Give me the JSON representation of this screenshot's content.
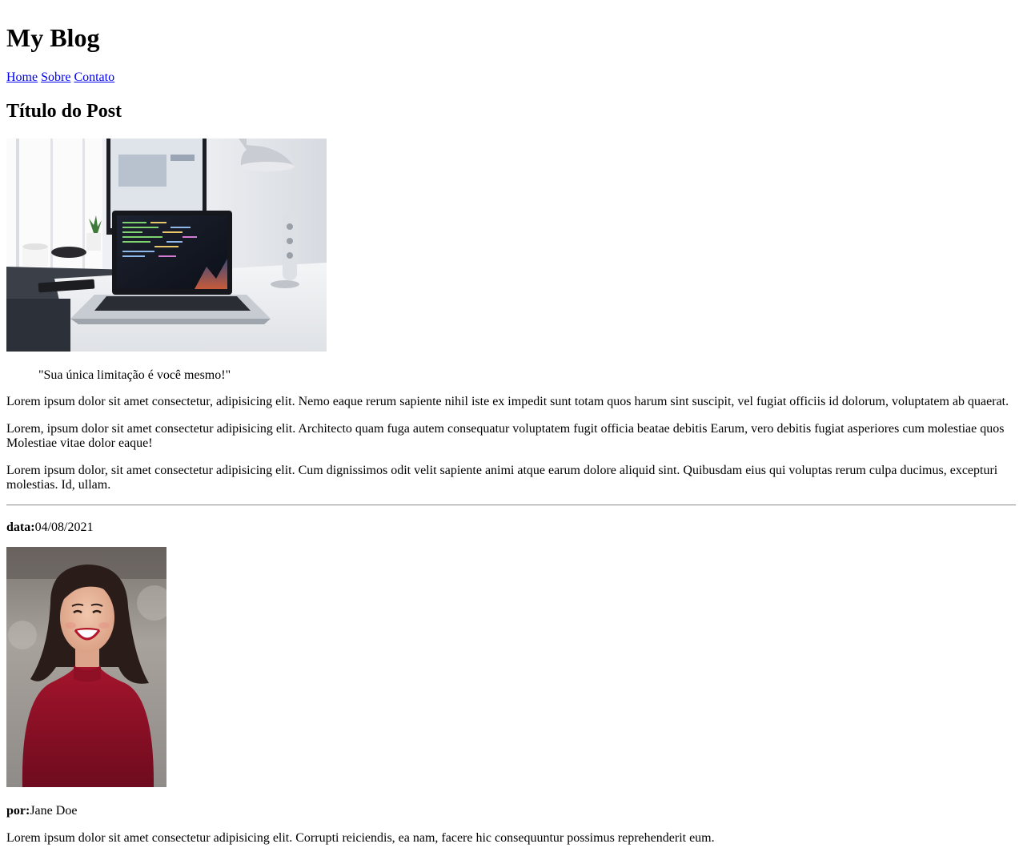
{
  "header": {
    "title": "My Blog"
  },
  "nav": {
    "links": [
      {
        "label": "Home"
      },
      {
        "label": "Sobre"
      },
      {
        "label": "Contato"
      }
    ]
  },
  "post": {
    "title": "Título do Post",
    "hero_image": {
      "icon": "laptop-desk-photo"
    },
    "quote": "\"Sua única limitação é você mesmo!\"",
    "paragraphs": [
      "Lorem ipsum dolor sit amet consectetur, adipisicing elit. Nemo eaque rerum sapiente nihil iste ex impedit sunt totam quos harum sint suscipit, vel fugiat officiis id dolorum, voluptatem ab quaerat.",
      "Lorem, ipsum dolor sit amet consectetur adipisicing elit. Architecto quam fuga autem consequatur voluptatem fugit officia beatae debitis Earum, vero debitis fugiat asperiores cum molestiae quos Molestiae vitae dolor eaque!",
      "Lorem ipsum dolor, sit amet consectetur adipisicing elit. Cum dignissimos odit velit sapiente animi atque earum dolore aliquid sint. Quibusdam eius qui voluptas rerum culpa ducimus, excepturi molestias. Id, ullam."
    ]
  },
  "footer": {
    "date_label": "data:",
    "date_value": "04/08/2021",
    "author_photo": {
      "icon": "author-portrait-photo"
    },
    "author_label": "por:",
    "author_name": "Jane Doe",
    "bio": "Lorem ipsum dolor sit amet consectetur adipisicing elit. Corrupti reiciendis, ea nam, facere hic consequuntur possimus reprehenderit eum."
  },
  "colors": {
    "link": "#0000ee",
    "text": "#000000",
    "separator": "#9a9a9a"
  }
}
